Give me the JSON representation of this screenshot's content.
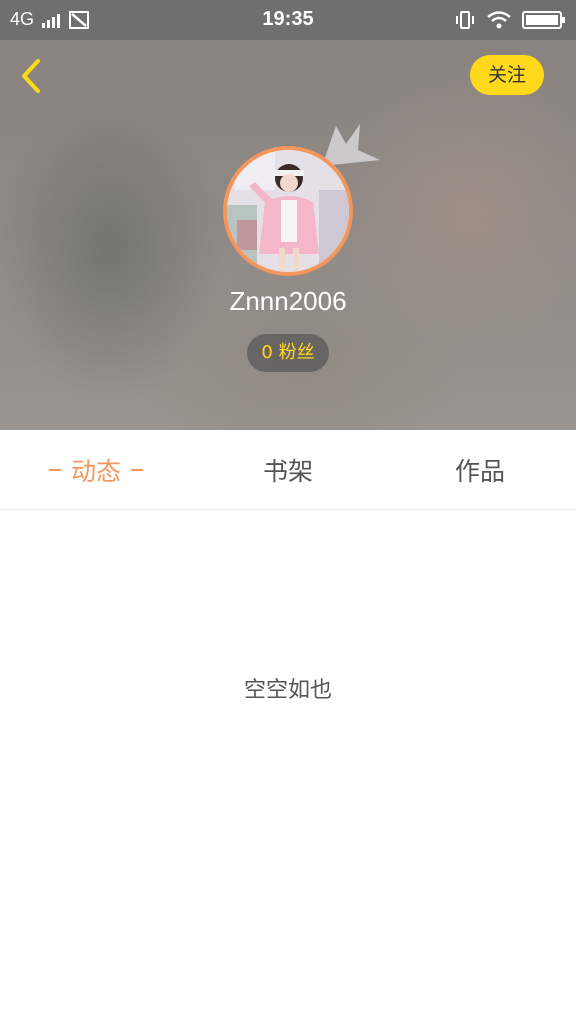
{
  "status_bar": {
    "network": "4G",
    "time": "19:35",
    "icons": [
      "signal-icon",
      "no-sim-icon",
      "vibrate-icon",
      "wifi-icon",
      "battery-icon"
    ],
    "battery_level": 1.0
  },
  "header": {
    "back_icon": "chevron-left-icon",
    "follow_label": "关注",
    "username": "Znnn2006",
    "fans_count": "0",
    "fans_label": "粉丝",
    "accent_color": "#f5965c",
    "follow_color": "#ffd91a"
  },
  "tabs": [
    {
      "label": "动态",
      "active": true
    },
    {
      "label": "书架",
      "active": false
    },
    {
      "label": "作品",
      "active": false
    }
  ],
  "content": {
    "empty_text": "空空如也"
  }
}
